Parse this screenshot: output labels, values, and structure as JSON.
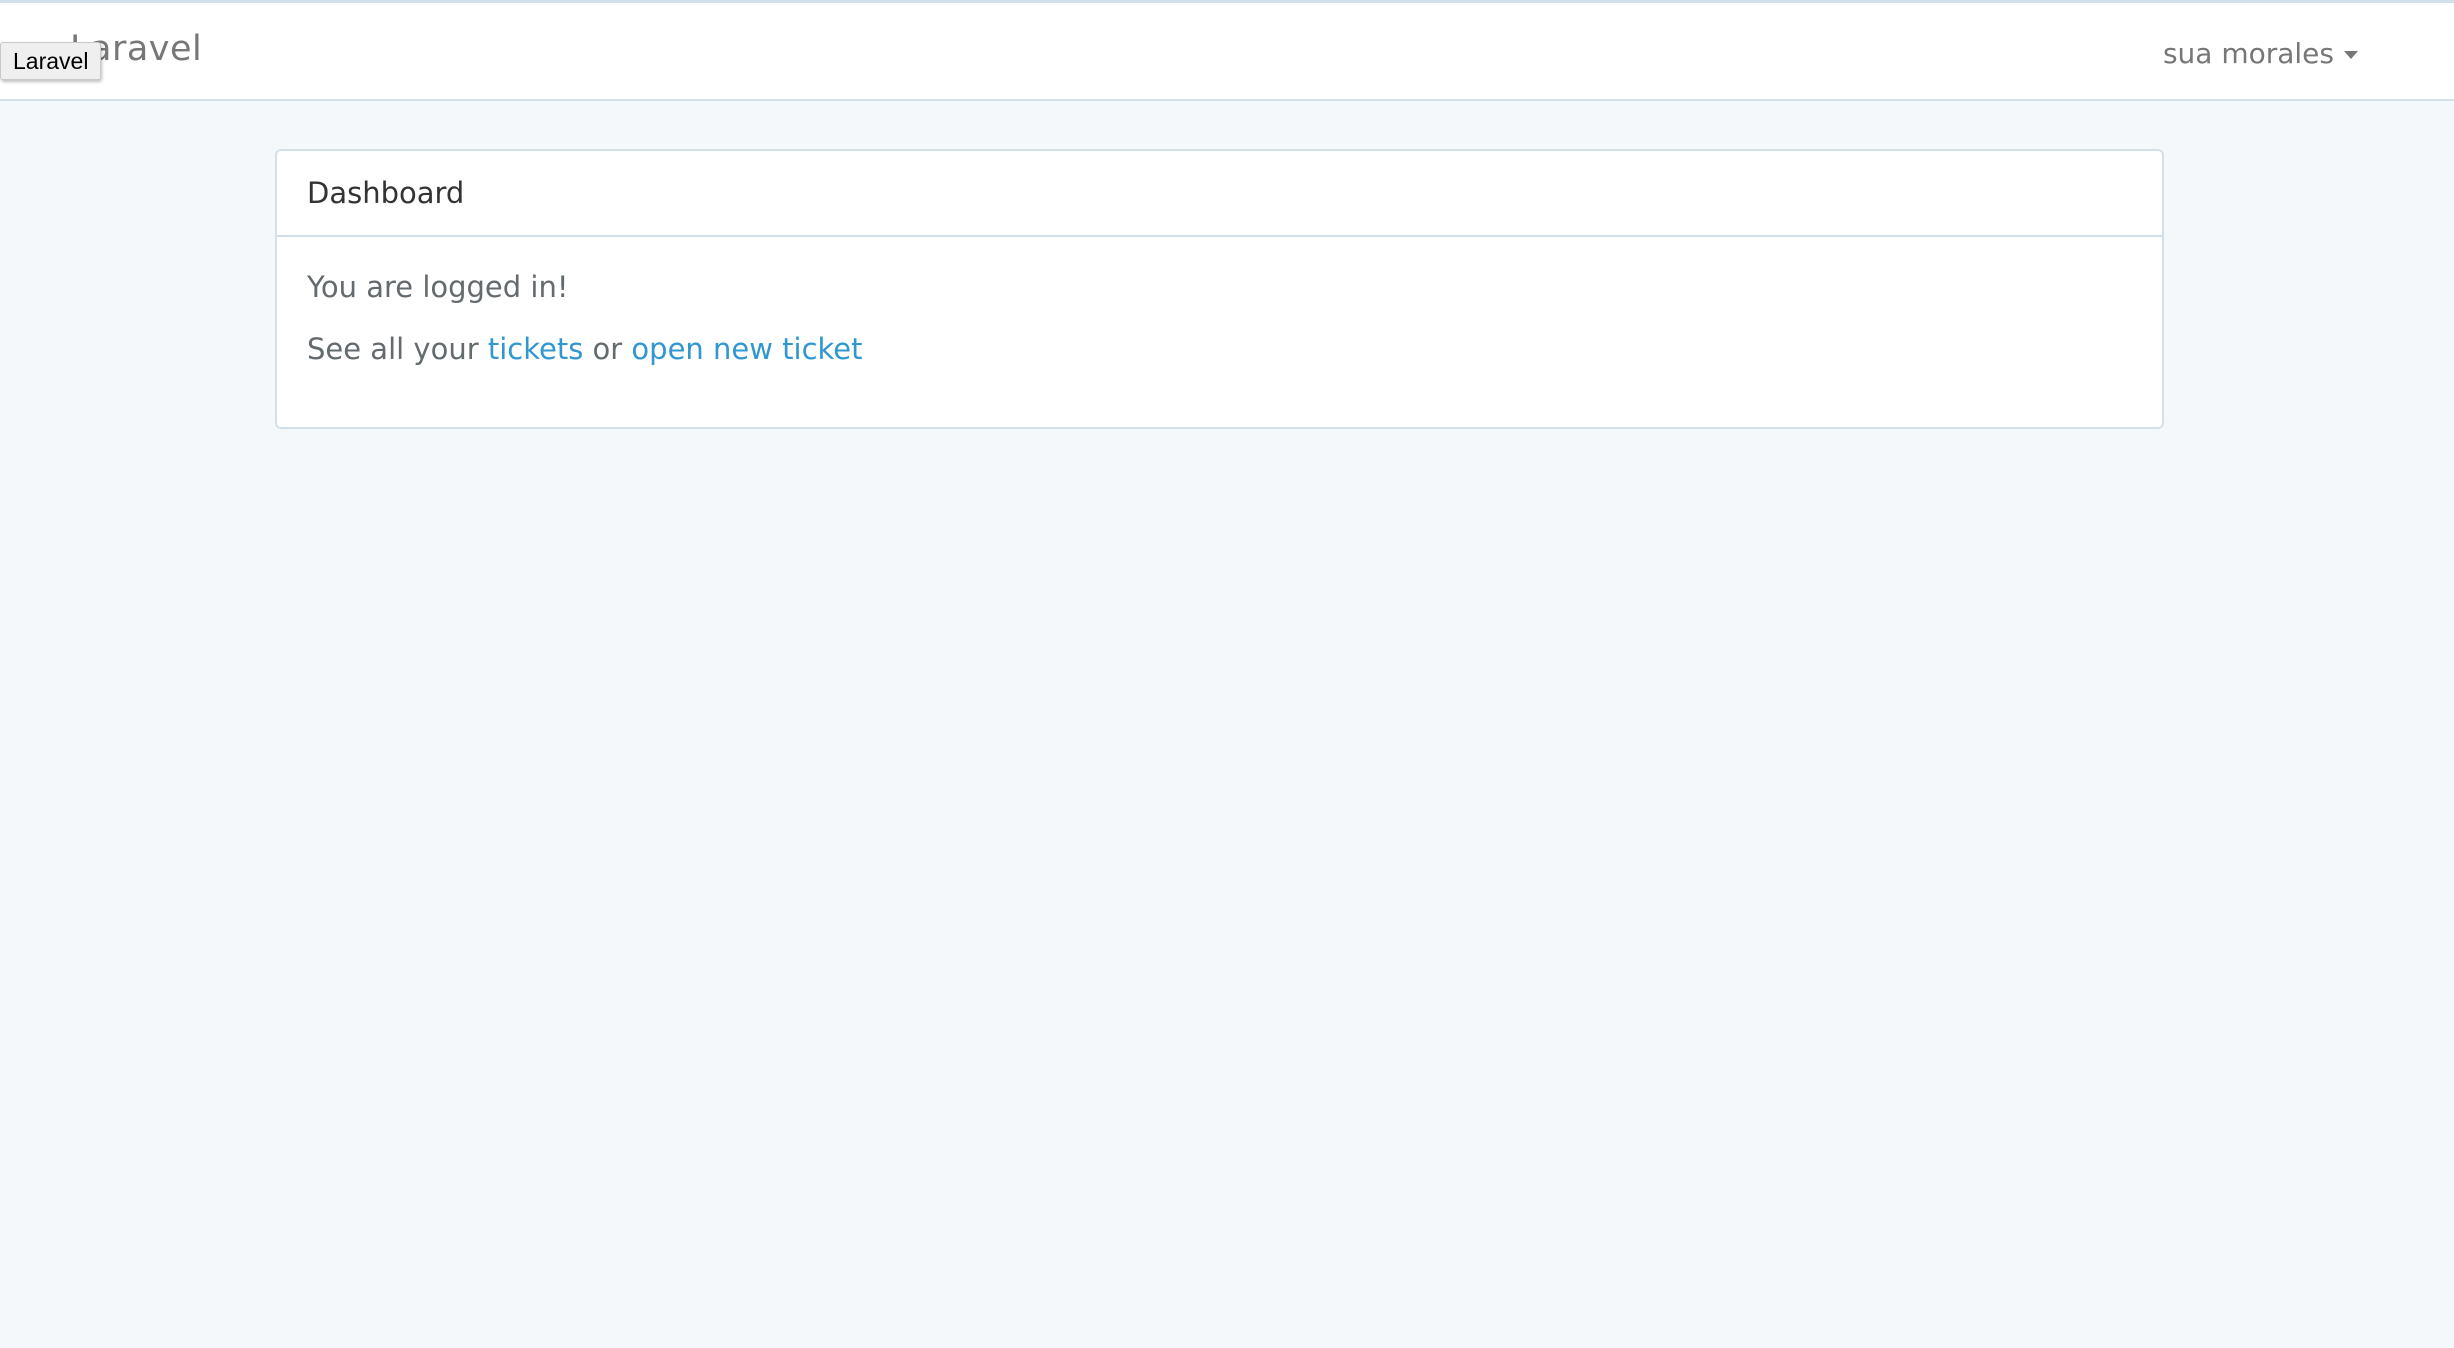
{
  "navbar": {
    "brand": "Laravel",
    "brand_tooltip": "Laravel",
    "user_name": "sua morales"
  },
  "panel": {
    "heading": "Dashboard",
    "status_text": "You are logged in!",
    "links_prefix": "See all your ",
    "tickets_link": "tickets",
    "links_middle": " or ",
    "new_ticket_link": "open new ticket"
  },
  "colors": {
    "link": "#3097d1",
    "background": "#f5f8fa",
    "border": "#d3e0e9"
  }
}
